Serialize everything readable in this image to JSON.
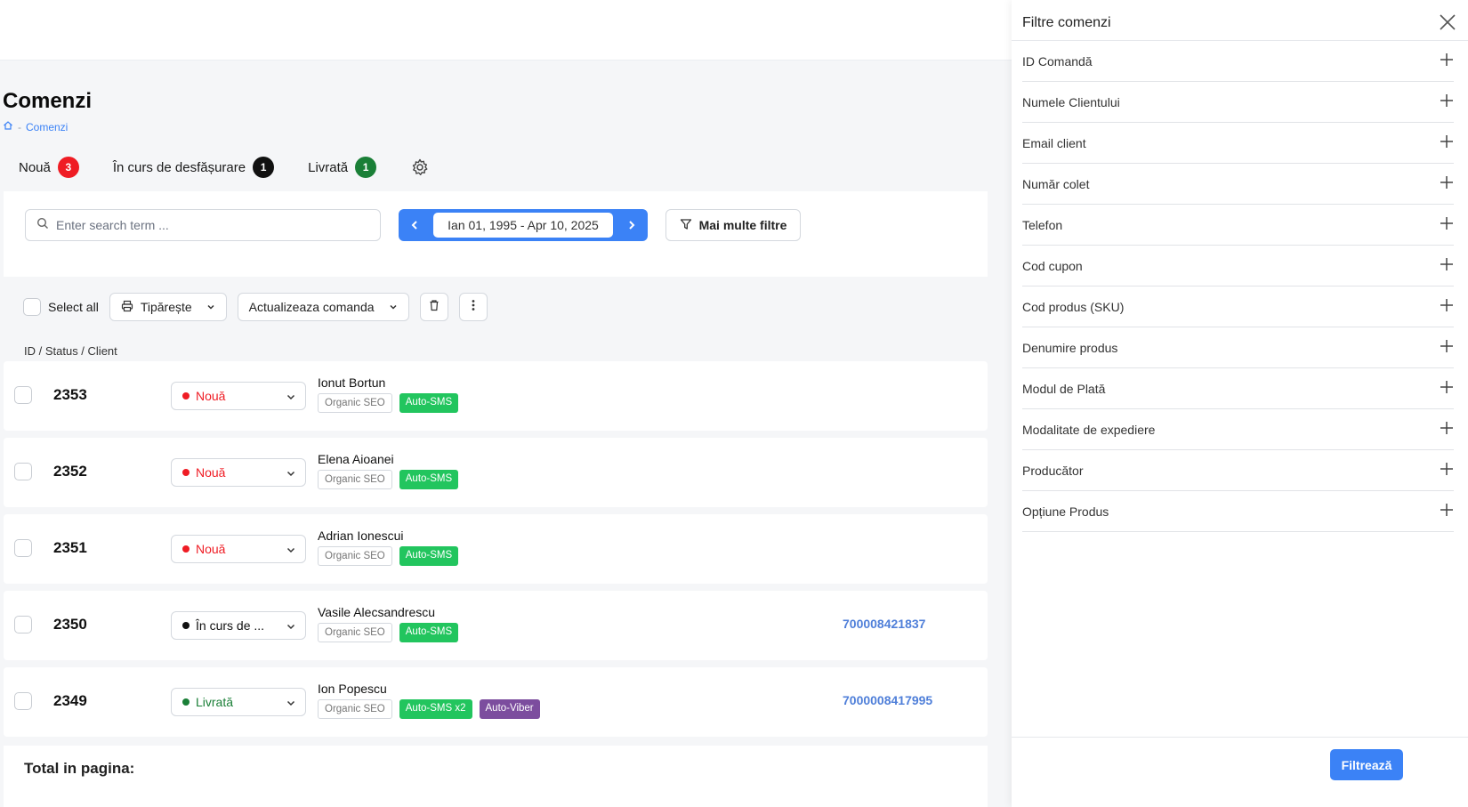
{
  "page": {
    "title": "Comenzi",
    "breadcrumb": {
      "current": "Comenzi",
      "separator": "-"
    }
  },
  "tabs": [
    {
      "label": "Nouă",
      "count": "3",
      "color": "#ef1c24"
    },
    {
      "label": "În curs de desfășurare",
      "count": "1",
      "color": "#111111"
    },
    {
      "label": "Livrată",
      "count": "1",
      "color": "#1a7f37"
    }
  ],
  "filters": {
    "search_placeholder": "Enter search term ...",
    "date_range": "Ian 01, 1995 - Apr 10, 2025",
    "more_filters_label": "Mai multe filtre"
  },
  "toolbar": {
    "select_all": "Select all",
    "print_label": "Tipărește",
    "update_label": "Actualizeaza comanda"
  },
  "table": {
    "header": "ID / Status / Client",
    "rows": [
      {
        "id": "2353",
        "status": "Nouă",
        "status_color": "#ef1c24",
        "client": "Ionut Bortun",
        "tags": [
          {
            "text": "Organic SEO",
            "style": "outline"
          },
          {
            "text": "Auto-SMS",
            "style": "green"
          }
        ],
        "awb": ""
      },
      {
        "id": "2352",
        "status": "Nouă",
        "status_color": "#ef1c24",
        "client": "Elena Aioanei",
        "tags": [
          {
            "text": "Organic SEO",
            "style": "outline"
          },
          {
            "text": "Auto-SMS",
            "style": "green"
          }
        ],
        "awb": ""
      },
      {
        "id": "2351",
        "status": "Nouă",
        "status_color": "#ef1c24",
        "client": "Adrian Ionescui",
        "tags": [
          {
            "text": "Organic SEO",
            "style": "outline"
          },
          {
            "text": "Auto-SMS",
            "style": "green"
          }
        ],
        "awb": ""
      },
      {
        "id": "2350",
        "status": "În curs de ...",
        "status_color": "#111111",
        "client": "Vasile Alecsandrescu",
        "tags": [
          {
            "text": "Organic SEO",
            "style": "outline"
          },
          {
            "text": "Auto-SMS",
            "style": "green"
          }
        ],
        "awb": "700008421837"
      },
      {
        "id": "2349",
        "status": "Livrată",
        "status_color": "#1a7f37",
        "client": "Ion Popescu",
        "tags": [
          {
            "text": "Organic SEO",
            "style": "outline"
          },
          {
            "text": "Auto-SMS x2",
            "style": "green"
          },
          {
            "text": "Auto-Viber",
            "style": "purple"
          }
        ],
        "awb": "7000008417995"
      }
    ],
    "total_label": "Total in pagina:"
  },
  "panel": {
    "title": "Filtre comenzi",
    "items": [
      "ID Comandă",
      "Numele Clientului",
      "Email client",
      "Număr colet",
      "Telefon",
      "Cod cupon",
      "Cod produs (SKU)",
      "Denumire produs",
      "Modul de Plată",
      "Modalitate de expediere",
      "Producător",
      "Opțiune Produs"
    ],
    "submit_label": "Filtrează"
  },
  "colors": {
    "accent": "#3b82f6",
    "status_new": "#ef1c24",
    "status_delivered": "#1a7f37",
    "tag_green": "#22c55e",
    "tag_purple": "#7c4d9e"
  }
}
